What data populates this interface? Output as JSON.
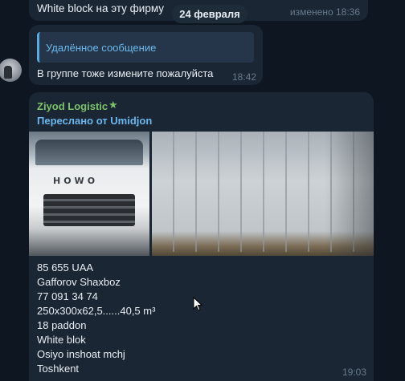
{
  "messages": {
    "top": {
      "text": "White block на эту фирму",
      "time": "изменено 18:36"
    },
    "date_separator": "24 февраля",
    "second": {
      "reply_text": "Удалённое сообщение",
      "text": "В группе тоже измените пожалуйста",
      "time": "18:42"
    },
    "main": {
      "sender": "Ziyod Logistic",
      "forwarded_from": "Переслано от Umidjon",
      "lines": [
        "85 655 UAA",
        "Gafforov Shaxboz",
        "77 091 34 74",
        "250x300x62,5......40,5 m³",
        "18 paddon",
        "White blok",
        "Osiyo inshoat mchj",
        "Toshkent"
      ],
      "time": "19:03",
      "truck_brand": "HOWO"
    }
  },
  "colors": {
    "background": "#0e1621",
    "bubble": "#1a2634",
    "sender_green": "#7cc26a",
    "link_blue": "#6cb8ee"
  },
  "icons": {
    "star": "star-icon",
    "cursor": "cursor-icon"
  }
}
